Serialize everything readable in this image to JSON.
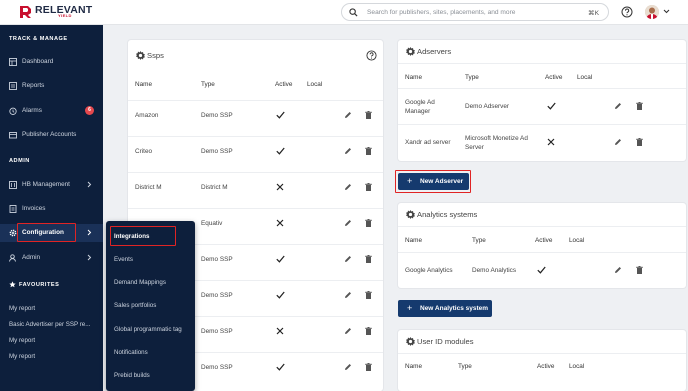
{
  "brand": {
    "name": "RELEVANT",
    "sub": "YIELD"
  },
  "search": {
    "placeholder": "Search for publishers, sites, placements, and more",
    "shortcut": "⌘K"
  },
  "sidebar": {
    "section_track": "TRACK & MANAGE",
    "dashboard": "Dashboard",
    "reports": "Reports",
    "alarms": "Alarms",
    "alarms_count": "6",
    "publisher_accounts": "Publisher Accounts",
    "section_admin": "ADMIN",
    "hb_management": "HB Management",
    "invoices": "Invoices",
    "configuration": "Configuration",
    "admin": "Admin",
    "section_favourites": "FAVOURITES",
    "fav_1": "My report",
    "fav_2": "Basic Advertiser per SSP re...",
    "fav_3": "My report",
    "fav_4": "My report"
  },
  "submenu": {
    "integrations": "Integrations",
    "events": "Events",
    "demand_mappings": "Demand Mappings",
    "sales_portfolios": "Sales portfolios",
    "global_tag": "Global programmatic tag",
    "notifications": "Notifications",
    "prebid_builds": "Prebid builds"
  },
  "ssps": {
    "title": "Ssps",
    "headers": {
      "name": "Name",
      "type": "Type",
      "active": "Active",
      "local": "Local"
    },
    "rows": [
      {
        "name": "Amazon",
        "type": "Demo SSP",
        "active": true
      },
      {
        "name": "Criteo",
        "type": "Demo SSP",
        "active": true
      },
      {
        "name": "District M",
        "type": "District M",
        "active": false
      },
      {
        "name": "",
        "type": "Equativ",
        "active": false
      },
      {
        "name": "",
        "type": "Demo SSP",
        "active": true
      },
      {
        "name": "",
        "type": "Demo SSP",
        "active": true
      },
      {
        "name": "",
        "type": "Demo SSP",
        "active": false
      },
      {
        "name": "",
        "type": "Demo SSP",
        "active": true
      }
    ]
  },
  "adservers": {
    "title": "Adservers",
    "headers": {
      "name": "Name",
      "type": "Type",
      "active": "Active",
      "local": "Local"
    },
    "rows": [
      {
        "name_1": "Google Ad",
        "name_2": "Manager",
        "type_1": "Demo Adserver",
        "type_2": "",
        "active": true
      },
      {
        "name_1": "Xandr ad server",
        "name_2": "",
        "type_1": "Microsoft Monetize Ad",
        "type_2": "Server",
        "active": false
      }
    ],
    "new_button": "New Adserver"
  },
  "analytics": {
    "title": "Analytics systems",
    "headers": {
      "name": "Name",
      "type": "Type",
      "active": "Active",
      "local": "Local"
    },
    "rows": [
      {
        "name": "Google Analytics",
        "type": "Demo Analytics",
        "active": true
      }
    ],
    "new_button": "New Analytics system"
  },
  "userid": {
    "title": "User ID modules",
    "headers": {
      "name": "Name",
      "type": "Type",
      "active": "Active",
      "local": "Local"
    }
  },
  "colors": {
    "sidebar_bg": "#0d1f3c",
    "primary": "#153a6e",
    "highlight": "#e02424",
    "badge": "#e5484d"
  },
  "icons": [
    "search-icon",
    "help-icon",
    "gear-icon",
    "edit-icon",
    "delete-icon",
    "check-icon",
    "x-icon",
    "chevron-right-icon",
    "star-icon"
  ]
}
